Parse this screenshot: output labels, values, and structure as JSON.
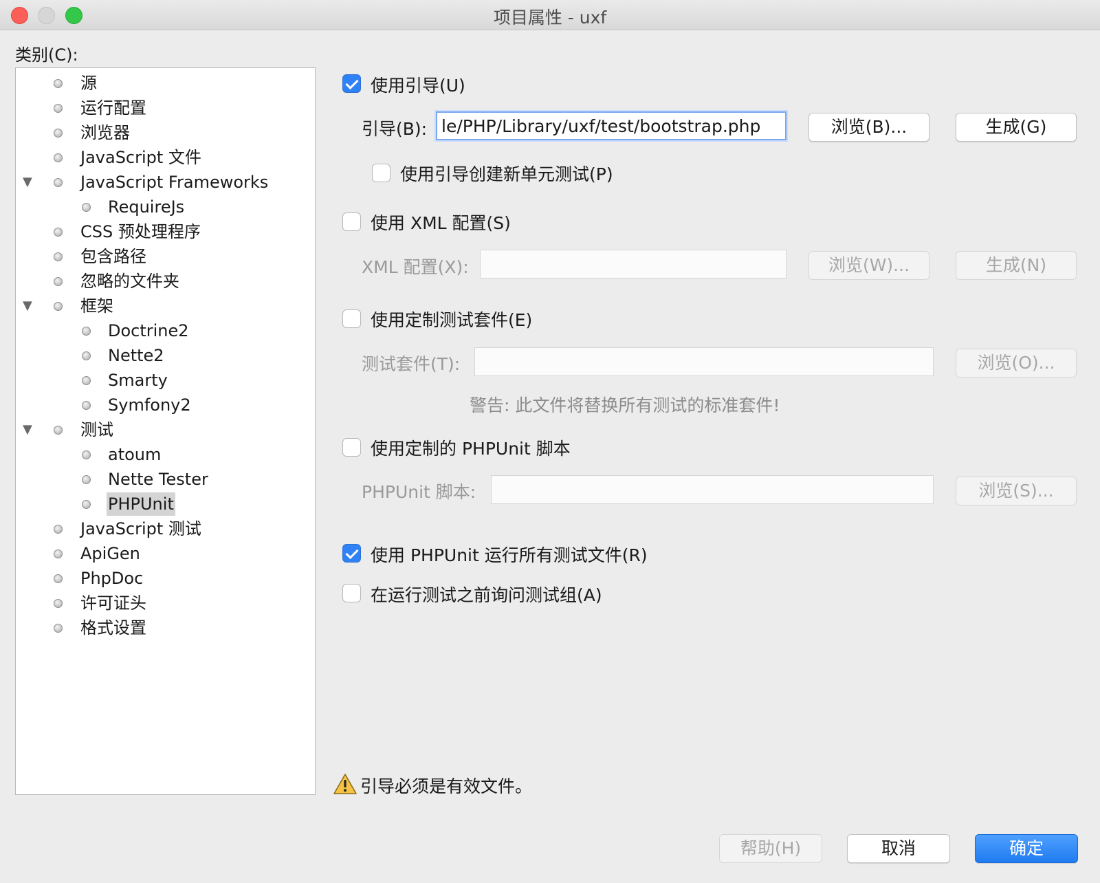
{
  "window": {
    "title": "项目属性 - uxf",
    "colors": {
      "close": "#fc5f57",
      "minimize": "#d6d6d6",
      "maximize": "#34c84a"
    }
  },
  "category_label": "类别(C):",
  "tree": {
    "items": [
      {
        "label": "源",
        "depth": 0,
        "expanded": null
      },
      {
        "label": "运行配置",
        "depth": 0,
        "expanded": null
      },
      {
        "label": "浏览器",
        "depth": 0,
        "expanded": null
      },
      {
        "label": "JavaScript 文件",
        "depth": 0,
        "expanded": null
      },
      {
        "label": "JavaScript Frameworks",
        "depth": 0,
        "expanded": true
      },
      {
        "label": "RequireJs",
        "depth": 1,
        "expanded": null
      },
      {
        "label": "CSS 预处理程序",
        "depth": 0,
        "expanded": null
      },
      {
        "label": "包含路径",
        "depth": 0,
        "expanded": null
      },
      {
        "label": "忽略的文件夹",
        "depth": 0,
        "expanded": null
      },
      {
        "label": "框架",
        "depth": 0,
        "expanded": true
      },
      {
        "label": "Doctrine2",
        "depth": 1,
        "expanded": null
      },
      {
        "label": "Nette2",
        "depth": 1,
        "expanded": null
      },
      {
        "label": "Smarty",
        "depth": 1,
        "expanded": null
      },
      {
        "label": "Symfony2",
        "depth": 1,
        "expanded": null
      },
      {
        "label": "测试",
        "depth": 0,
        "expanded": true
      },
      {
        "label": "atoum",
        "depth": 1,
        "expanded": null
      },
      {
        "label": "Nette Tester",
        "depth": 1,
        "expanded": null
      },
      {
        "label": "PHPUnit",
        "depth": 1,
        "expanded": null,
        "selected": true
      },
      {
        "label": "JavaScript 测试",
        "depth": 0,
        "expanded": null
      },
      {
        "label": "ApiGen",
        "depth": 0,
        "expanded": null
      },
      {
        "label": "PhpDoc",
        "depth": 0,
        "expanded": null
      },
      {
        "label": "许可证头",
        "depth": 0,
        "expanded": null
      },
      {
        "label": "格式设置",
        "depth": 0,
        "expanded": null
      }
    ]
  },
  "bootstrap": {
    "use_label": "使用引导(U)",
    "checked": true,
    "field_label": "引导(B):",
    "value": "le/PHP/Library/uxf/test/bootstrap.php",
    "browse_label": "浏览(B)...",
    "generate_label": "生成(G)",
    "create_tests_label": "使用引导创建新单元测试(P)",
    "create_tests_checked": false
  },
  "xml": {
    "use_label": "使用 XML 配置(S)",
    "checked": false,
    "field_label": "XML 配置(X):",
    "value": "",
    "browse_label": "浏览(W)...",
    "generate_label": "生成(N)"
  },
  "suite": {
    "use_label": "使用定制测试套件(E)",
    "checked": false,
    "field_label": "测试套件(T):",
    "value": "",
    "browse_label": "浏览(O)...",
    "warning": "警告: 此文件将替换所有测试的标准套件!"
  },
  "script": {
    "use_label": "使用定制的 PHPUnit 脚本",
    "checked": false,
    "field_label": "PHPUnit 脚本:",
    "value": "",
    "browse_label": "浏览(S)..."
  },
  "run_all": {
    "label": "使用 PHPUnit 运行所有测试文件(R)",
    "checked": true
  },
  "ask_groups": {
    "label": "在运行测试之前询问测试组(A)",
    "checked": false
  },
  "status": {
    "icon": "warning-icon",
    "message": "引导必须是有效文件。"
  },
  "footer": {
    "help_label": "帮助(H)",
    "cancel_label": "取消",
    "ok_label": "确定"
  },
  "colors": {
    "accent": "#2f82f5",
    "primary_button": "#1f7bf0"
  }
}
